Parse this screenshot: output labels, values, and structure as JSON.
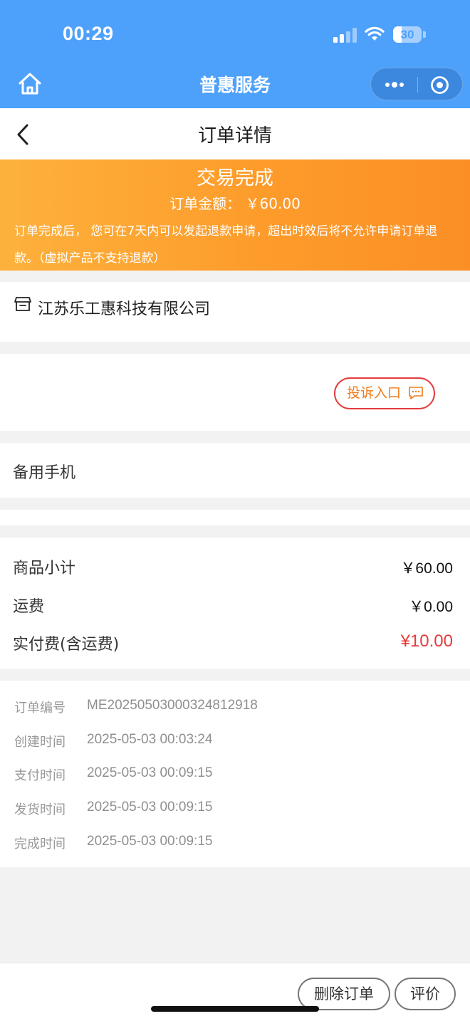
{
  "status_bar": {
    "time": "00:29",
    "battery": "30",
    "battery_level": 0.3
  },
  "mini_program": {
    "title": "普惠服务"
  },
  "nav": {
    "title": "订单详情"
  },
  "banner": {
    "status": "交易完成",
    "amount": "订单金额： ￥60.00",
    "notice": "订单完成后， 您可在7天内可以发起退款申请，超出时效后将不允许申请订单退款。（虚拟产品不支持退款）"
  },
  "shop": {
    "name": "江苏乐工惠科技有限公司"
  },
  "complaint": {
    "label": "投诉入口"
  },
  "backup_phone": {
    "label": "备用手机"
  },
  "costs": {
    "subtotal_label": "商品小计",
    "subtotal_value": "￥60.00",
    "shipping_label": "运费",
    "shipping_value": "￥0.00",
    "paid_label": "实付费(含运费)",
    "paid_value": "¥10.00"
  },
  "order_info": [
    {
      "label": "订单编号",
      "value": "ME20250503000324812918"
    },
    {
      "label": "创建时间",
      "value": "2025-05-03 00:03:24"
    },
    {
      "label": "支付时间",
      "value": "2025-05-03 00:09:15"
    },
    {
      "label": "发货时间",
      "value": "2025-05-03 00:09:15"
    },
    {
      "label": "完成时间",
      "value": "2025-05-03 00:09:15"
    }
  ],
  "footer": {
    "delete_label": "删除订单",
    "rate_label": "评价"
  },
  "colors": {
    "header_blue": "#4ea1fb",
    "banner_orange": "#fd9c2b",
    "price_red": "#e83b3b",
    "complaint_text": "#ee7a18"
  }
}
